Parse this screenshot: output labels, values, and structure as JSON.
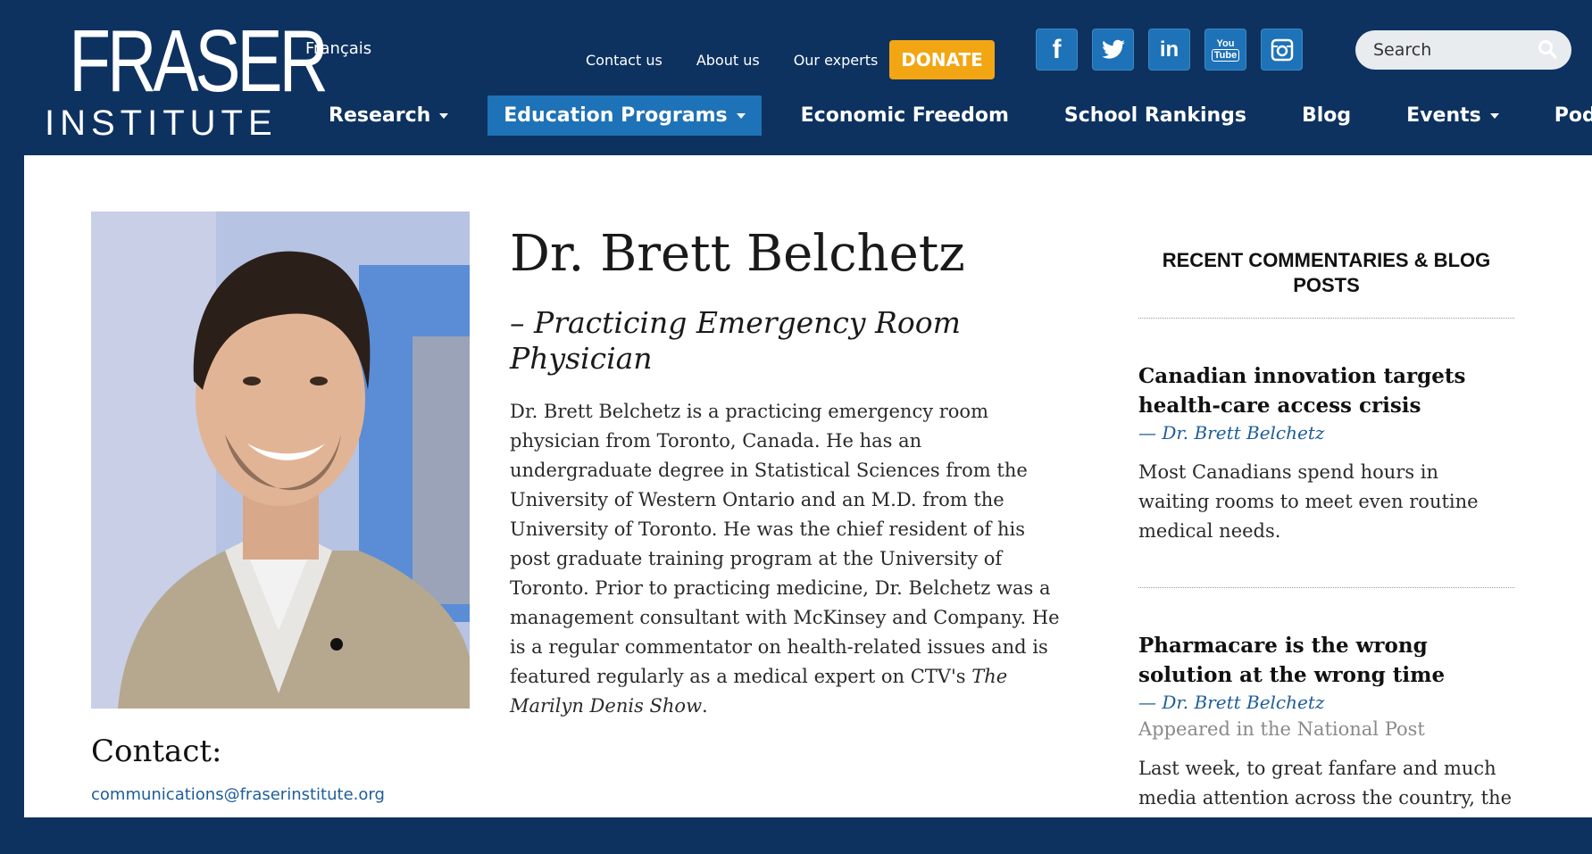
{
  "header": {
    "logo": {
      "line1": "FRASER",
      "line2": "INSTITUTE"
    },
    "language_link": "Français",
    "top_links": [
      "Contact us",
      "About us",
      "Our experts"
    ],
    "donate_label": "DONATE",
    "social": [
      {
        "icon": "facebook-icon",
        "glyph": "f"
      },
      {
        "icon": "twitter-icon",
        "glyph": "🐦"
      },
      {
        "icon": "linkedin-icon",
        "glyph": "in"
      },
      {
        "icon": "youtube-icon",
        "glyph": "You Tube"
      },
      {
        "icon": "instagram-icon",
        "glyph": "◎"
      }
    ],
    "search": {
      "placeholder": "Search"
    }
  },
  "nav": [
    {
      "label": "Research",
      "dropdown": true,
      "active": false
    },
    {
      "label": "Education Programs",
      "dropdown": true,
      "active": true
    },
    {
      "label": "Economic Freedom",
      "dropdown": false,
      "active": false
    },
    {
      "label": "School Rankings",
      "dropdown": false,
      "active": false
    },
    {
      "label": "Blog",
      "dropdown": false,
      "active": false
    },
    {
      "label": "Events",
      "dropdown": true,
      "active": false
    },
    {
      "label": "Podcast",
      "dropdown": true,
      "active": false
    }
  ],
  "profile": {
    "name": "Dr. Brett Belchetz",
    "title": "– Practicing Emergency Room Physician",
    "bio_main": "Dr. Brett Belchetz is a practicing emergency room physician from Toronto, Canada. He has an undergraduate degree in Statistical Sciences from the University of Western Ontario and an M.D. from the University of Toronto. He was the chief resident of his post graduate training program at the University of Toronto. Prior to practicing medicine, Dr. Belchetz was a management consultant with McKinsey and Company. He is a regular commentator on health-related issues and is featured regularly as a medical expert on CTV's ",
    "bio_show": "The Marilyn Denis Show",
    "bio_end": ".",
    "contact_heading": "Contact:",
    "contact_email": "communications@fraserinstitute.org"
  },
  "sidebar": {
    "heading": "RECENT COMMENTARIES & BLOG POSTS",
    "posts": [
      {
        "title": "Canadian innovation targets health-care access crisis",
        "author": "— Dr. Brett Belchetz",
        "appeared": "",
        "excerpt": "Most Canadians spend hours in waiting rooms to meet even routine medical needs."
      },
      {
        "title": "Pharmacare is the wrong solution at the wrong time",
        "author": "— Dr. Brett Belchetz",
        "appeared": "Appeared in the National Post",
        "excerpt": "Last week, to great fanfare and much media attention across the country, the"
      }
    ]
  },
  "colors": {
    "header_bg": "#0d3260",
    "accent_blue": "#1e72b7",
    "donate": "#f3a613",
    "link": "#1e5d99"
  }
}
